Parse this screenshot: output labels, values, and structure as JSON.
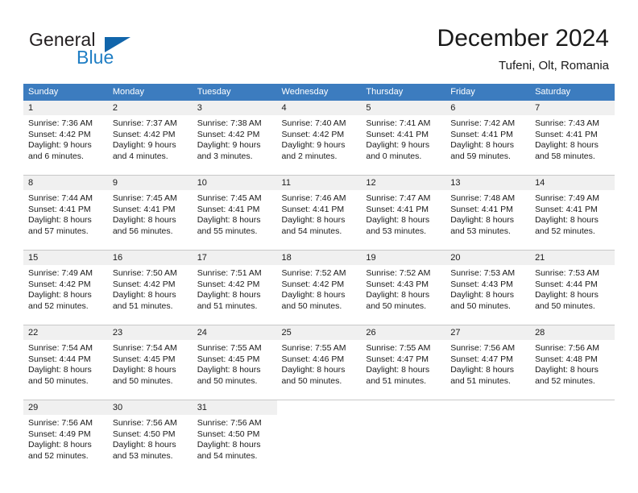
{
  "logo": {
    "word_top": "General",
    "word_bottom": "Blue",
    "triangle_color": "#1165ab",
    "blue_color": "#1f7ec4"
  },
  "header": {
    "month_title": "December 2024",
    "location": "Tufeni, Olt, Romania"
  },
  "theme": {
    "header_row_bg": "#3c7cbf",
    "daynum_strip_bg": "#f0f0f0",
    "grid_line": "#c8c8c8",
    "text": "#1a1a1a"
  },
  "weekday_headers": [
    "Sunday",
    "Monday",
    "Tuesday",
    "Wednesday",
    "Thursday",
    "Friday",
    "Saturday"
  ],
  "weeks": [
    [
      {
        "day": "1",
        "sunrise": "Sunrise: 7:36 AM",
        "sunset": "Sunset: 4:42 PM",
        "daylight_1": "Daylight: 9 hours",
        "daylight_2": "and 6 minutes."
      },
      {
        "day": "2",
        "sunrise": "Sunrise: 7:37 AM",
        "sunset": "Sunset: 4:42 PM",
        "daylight_1": "Daylight: 9 hours",
        "daylight_2": "and 4 minutes."
      },
      {
        "day": "3",
        "sunrise": "Sunrise: 7:38 AM",
        "sunset": "Sunset: 4:42 PM",
        "daylight_1": "Daylight: 9 hours",
        "daylight_2": "and 3 minutes."
      },
      {
        "day": "4",
        "sunrise": "Sunrise: 7:40 AM",
        "sunset": "Sunset: 4:42 PM",
        "daylight_1": "Daylight: 9 hours",
        "daylight_2": "and 2 minutes."
      },
      {
        "day": "5",
        "sunrise": "Sunrise: 7:41 AM",
        "sunset": "Sunset: 4:41 PM",
        "daylight_1": "Daylight: 9 hours",
        "daylight_2": "and 0 minutes."
      },
      {
        "day": "6",
        "sunrise": "Sunrise: 7:42 AM",
        "sunset": "Sunset: 4:41 PM",
        "daylight_1": "Daylight: 8 hours",
        "daylight_2": "and 59 minutes."
      },
      {
        "day": "7",
        "sunrise": "Sunrise: 7:43 AM",
        "sunset": "Sunset: 4:41 PM",
        "daylight_1": "Daylight: 8 hours",
        "daylight_2": "and 58 minutes."
      }
    ],
    [
      {
        "day": "8",
        "sunrise": "Sunrise: 7:44 AM",
        "sunset": "Sunset: 4:41 PM",
        "daylight_1": "Daylight: 8 hours",
        "daylight_2": "and 57 minutes."
      },
      {
        "day": "9",
        "sunrise": "Sunrise: 7:45 AM",
        "sunset": "Sunset: 4:41 PM",
        "daylight_1": "Daylight: 8 hours",
        "daylight_2": "and 56 minutes."
      },
      {
        "day": "10",
        "sunrise": "Sunrise: 7:45 AM",
        "sunset": "Sunset: 4:41 PM",
        "daylight_1": "Daylight: 8 hours",
        "daylight_2": "and 55 minutes."
      },
      {
        "day": "11",
        "sunrise": "Sunrise: 7:46 AM",
        "sunset": "Sunset: 4:41 PM",
        "daylight_1": "Daylight: 8 hours",
        "daylight_2": "and 54 minutes."
      },
      {
        "day": "12",
        "sunrise": "Sunrise: 7:47 AM",
        "sunset": "Sunset: 4:41 PM",
        "daylight_1": "Daylight: 8 hours",
        "daylight_2": "and 53 minutes."
      },
      {
        "day": "13",
        "sunrise": "Sunrise: 7:48 AM",
        "sunset": "Sunset: 4:41 PM",
        "daylight_1": "Daylight: 8 hours",
        "daylight_2": "and 53 minutes."
      },
      {
        "day": "14",
        "sunrise": "Sunrise: 7:49 AM",
        "sunset": "Sunset: 4:41 PM",
        "daylight_1": "Daylight: 8 hours",
        "daylight_2": "and 52 minutes."
      }
    ],
    [
      {
        "day": "15",
        "sunrise": "Sunrise: 7:49 AM",
        "sunset": "Sunset: 4:42 PM",
        "daylight_1": "Daylight: 8 hours",
        "daylight_2": "and 52 minutes."
      },
      {
        "day": "16",
        "sunrise": "Sunrise: 7:50 AM",
        "sunset": "Sunset: 4:42 PM",
        "daylight_1": "Daylight: 8 hours",
        "daylight_2": "and 51 minutes."
      },
      {
        "day": "17",
        "sunrise": "Sunrise: 7:51 AM",
        "sunset": "Sunset: 4:42 PM",
        "daylight_1": "Daylight: 8 hours",
        "daylight_2": "and 51 minutes."
      },
      {
        "day": "18",
        "sunrise": "Sunrise: 7:52 AM",
        "sunset": "Sunset: 4:42 PM",
        "daylight_1": "Daylight: 8 hours",
        "daylight_2": "and 50 minutes."
      },
      {
        "day": "19",
        "sunrise": "Sunrise: 7:52 AM",
        "sunset": "Sunset: 4:43 PM",
        "daylight_1": "Daylight: 8 hours",
        "daylight_2": "and 50 minutes."
      },
      {
        "day": "20",
        "sunrise": "Sunrise: 7:53 AM",
        "sunset": "Sunset: 4:43 PM",
        "daylight_1": "Daylight: 8 hours",
        "daylight_2": "and 50 minutes."
      },
      {
        "day": "21",
        "sunrise": "Sunrise: 7:53 AM",
        "sunset": "Sunset: 4:44 PM",
        "daylight_1": "Daylight: 8 hours",
        "daylight_2": "and 50 minutes."
      }
    ],
    [
      {
        "day": "22",
        "sunrise": "Sunrise: 7:54 AM",
        "sunset": "Sunset: 4:44 PM",
        "daylight_1": "Daylight: 8 hours",
        "daylight_2": "and 50 minutes."
      },
      {
        "day": "23",
        "sunrise": "Sunrise: 7:54 AM",
        "sunset": "Sunset: 4:45 PM",
        "daylight_1": "Daylight: 8 hours",
        "daylight_2": "and 50 minutes."
      },
      {
        "day": "24",
        "sunrise": "Sunrise: 7:55 AM",
        "sunset": "Sunset: 4:45 PM",
        "daylight_1": "Daylight: 8 hours",
        "daylight_2": "and 50 minutes."
      },
      {
        "day": "25",
        "sunrise": "Sunrise: 7:55 AM",
        "sunset": "Sunset: 4:46 PM",
        "daylight_1": "Daylight: 8 hours",
        "daylight_2": "and 50 minutes."
      },
      {
        "day": "26",
        "sunrise": "Sunrise: 7:55 AM",
        "sunset": "Sunset: 4:47 PM",
        "daylight_1": "Daylight: 8 hours",
        "daylight_2": "and 51 minutes."
      },
      {
        "day": "27",
        "sunrise": "Sunrise: 7:56 AM",
        "sunset": "Sunset: 4:47 PM",
        "daylight_1": "Daylight: 8 hours",
        "daylight_2": "and 51 minutes."
      },
      {
        "day": "28",
        "sunrise": "Sunrise: 7:56 AM",
        "sunset": "Sunset: 4:48 PM",
        "daylight_1": "Daylight: 8 hours",
        "daylight_2": "and 52 minutes."
      }
    ],
    [
      {
        "day": "29",
        "sunrise": "Sunrise: 7:56 AM",
        "sunset": "Sunset: 4:49 PM",
        "daylight_1": "Daylight: 8 hours",
        "daylight_2": "and 52 minutes."
      },
      {
        "day": "30",
        "sunrise": "Sunrise: 7:56 AM",
        "sunset": "Sunset: 4:50 PM",
        "daylight_1": "Daylight: 8 hours",
        "daylight_2": "and 53 minutes."
      },
      {
        "day": "31",
        "sunrise": "Sunrise: 7:56 AM",
        "sunset": "Sunset: 4:50 PM",
        "daylight_1": "Daylight: 8 hours",
        "daylight_2": "and 54 minutes."
      },
      {
        "day": "",
        "sunrise": "",
        "sunset": "",
        "daylight_1": "",
        "daylight_2": ""
      },
      {
        "day": "",
        "sunrise": "",
        "sunset": "",
        "daylight_1": "",
        "daylight_2": ""
      },
      {
        "day": "",
        "sunrise": "",
        "sunset": "",
        "daylight_1": "",
        "daylight_2": ""
      },
      {
        "day": "",
        "sunrise": "",
        "sunset": "",
        "daylight_1": "",
        "daylight_2": ""
      }
    ]
  ]
}
